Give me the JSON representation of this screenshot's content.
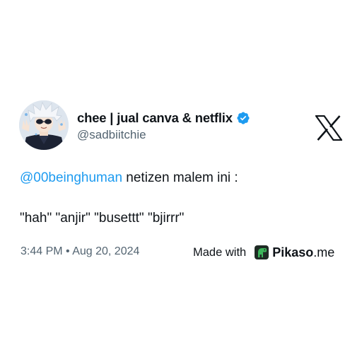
{
  "tweet": {
    "author": {
      "display_name": "chee | jual canva & netflix",
      "handle": "@sadbiitchie",
      "verified": true,
      "avatar": "anime-character-avatar"
    },
    "mention": "@00beinghuman",
    "line1_text": " netizen malem ini :",
    "line2_text": "\"hah\" \"anjir\" \"busettt\" \"bjirrr\"",
    "timestamp": "3:44 PM • Aug 20, 2024",
    "platform_icon": "x-logo-icon"
  },
  "footer": {
    "made_with": "Made with",
    "brand_name": "Pikaso",
    "brand_tld": ".me",
    "brand_icon": "pikaso-dino-icon"
  },
  "colors": {
    "link": "#1d9bf0",
    "verified": "#1d9bf0",
    "secondary_text": "#536471",
    "primary_text": "#0f1419",
    "brand_green": "#3cb55a"
  }
}
